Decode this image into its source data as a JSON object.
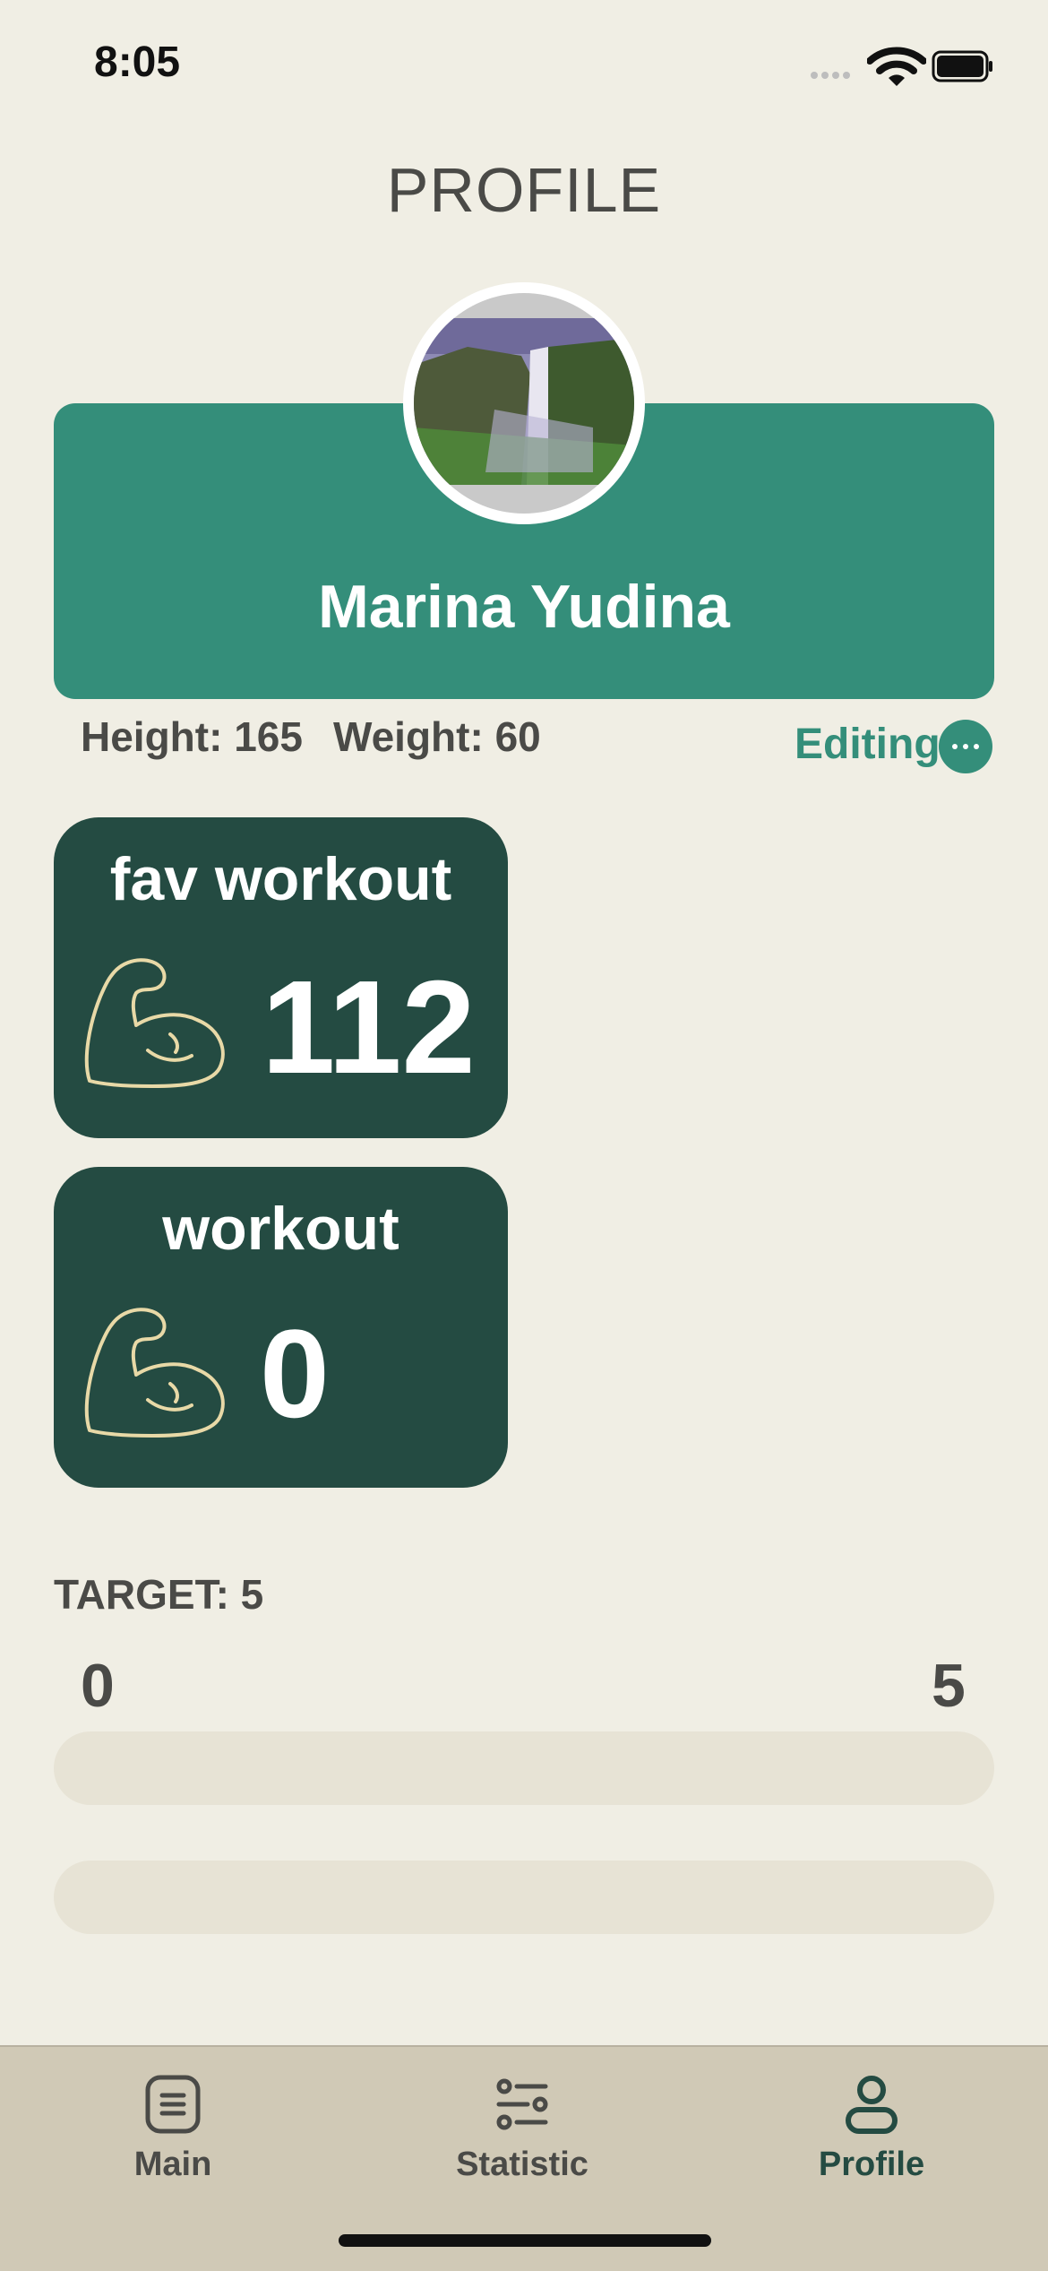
{
  "status_bar": {
    "time": "8:05"
  },
  "header": {
    "title": "PROFILE"
  },
  "profile": {
    "name": "Marina Yudina",
    "height_text": "Height: 165",
    "weight_text": "Weight: 60",
    "editing_label": "Editing"
  },
  "cards": [
    {
      "title": "fav workout",
      "value": "112",
      "icon": "flexed-biceps-icon"
    },
    {
      "title": "workout",
      "value": "0",
      "icon": "flexed-biceps-icon"
    }
  ],
  "target": {
    "label": "TARGET: 5",
    "min": "0",
    "max": "5",
    "progress_bars": [
      0,
      0
    ]
  },
  "tabbar": {
    "items": [
      {
        "label": "Main",
        "icon": "list-icon",
        "active": false
      },
      {
        "label": "Statistic",
        "icon": "sliders-icon",
        "active": false
      },
      {
        "label": "Profile",
        "icon": "person-icon",
        "active": true
      }
    ]
  },
  "colors": {
    "background": "#F0EEE4",
    "accent": "#348E7A",
    "card": "#244B42",
    "tabbar": "#D0C9B6",
    "active_tab": "#244B42",
    "inactive_tab": "#4A4A47"
  }
}
